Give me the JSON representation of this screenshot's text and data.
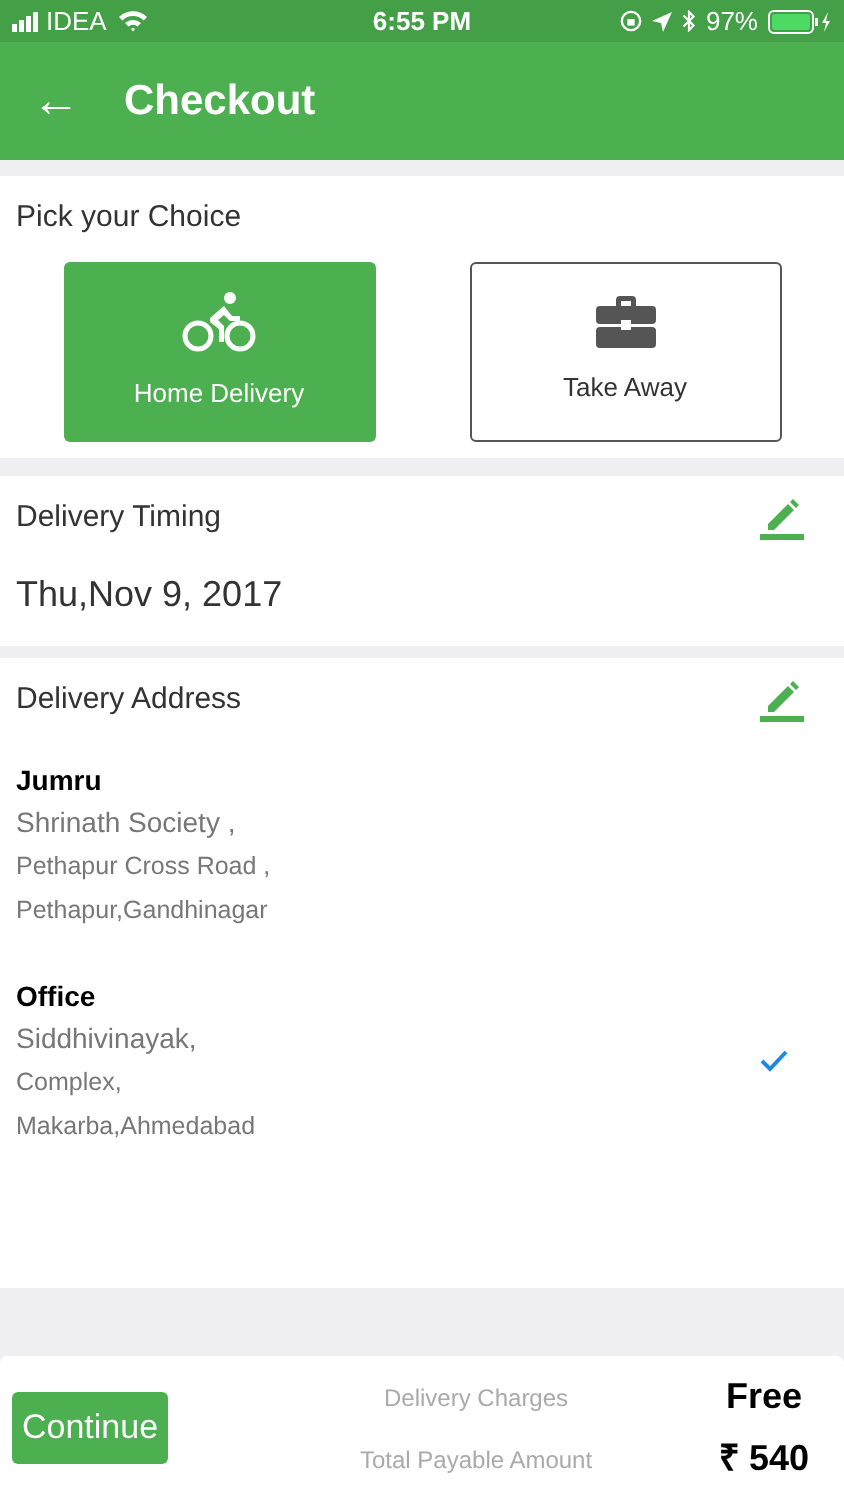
{
  "status_bar": {
    "carrier": "IDEA",
    "time": "6:55 PM",
    "battery": "97%"
  },
  "header": {
    "back": "←",
    "title": "Checkout"
  },
  "choice": {
    "title": "Pick your Choice",
    "options": [
      {
        "label": "Home Delivery",
        "kind": "bike",
        "selected": true
      },
      {
        "label": "Take Away",
        "kind": "briefcase",
        "selected": false
      }
    ]
  },
  "timing": {
    "title": "Delivery Timing",
    "value": "Thu,Nov 9, 2017"
  },
  "address": {
    "title": "Delivery Address",
    "items": [
      {
        "name": "Jumru",
        "lines": [
          "Shrinath Society ,",
          "Pethapur Cross Road ,",
          "Pethapur,Gandhinagar"
        ],
        "selected": false
      },
      {
        "name": "Office",
        "lines": [
          "Siddhivinayak,",
          "Complex,",
          "Makarba,Ahmedabad"
        ],
        "selected": true
      }
    ]
  },
  "footer": {
    "button": "Continue",
    "rows": [
      {
        "label": "Delivery Charges",
        "value": "Free"
      },
      {
        "label": "Total Payable Amount",
        "value": "₹ 540"
      }
    ]
  }
}
